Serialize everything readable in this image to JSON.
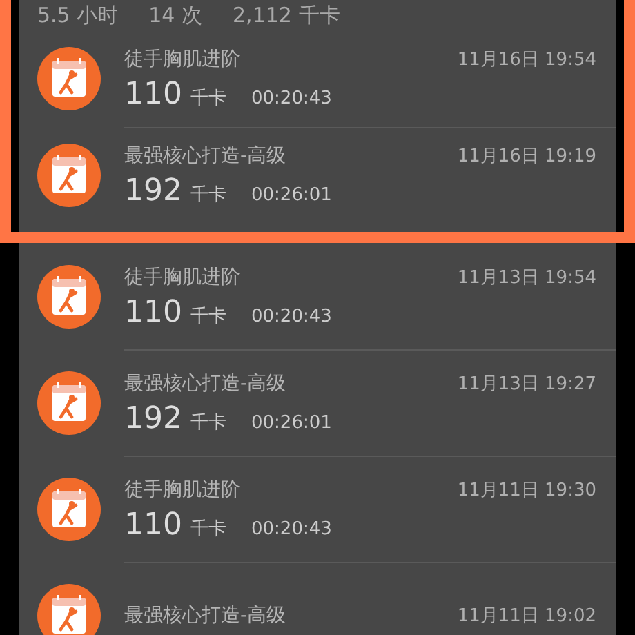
{
  "highlight": {
    "summary": [
      {
        "value": "5.5",
        "unit": "小时"
      },
      {
        "value": "14",
        "unit": "次"
      },
      {
        "value": "2,112",
        "unit": "千卡"
      }
    ],
    "records": [
      {
        "title": "徒手胸肌进阶",
        "datetime": "11月16日 19:54",
        "calories": "110",
        "unit": "千卡",
        "duration": "00:20:43"
      },
      {
        "title": "最强核心打造-高级",
        "datetime": "11月16日 19:19",
        "calories": "192",
        "unit": "千卡",
        "duration": "00:26:01"
      }
    ]
  },
  "records": [
    {
      "title": "徒手胸肌进阶",
      "datetime": "11月13日 19:54",
      "calories": "110",
      "unit": "千卡",
      "duration": "00:20:43"
    },
    {
      "title": "最强核心打造-高级",
      "datetime": "11月13日 19:27",
      "calories": "192",
      "unit": "千卡",
      "duration": "00:26:01"
    },
    {
      "title": "徒手胸肌进阶",
      "datetime": "11月11日 19:30",
      "calories": "110",
      "unit": "千卡",
      "duration": "00:20:43"
    },
    {
      "title": "最强核心打造-高级",
      "datetime": "11月11日 19:02"
    }
  ]
}
